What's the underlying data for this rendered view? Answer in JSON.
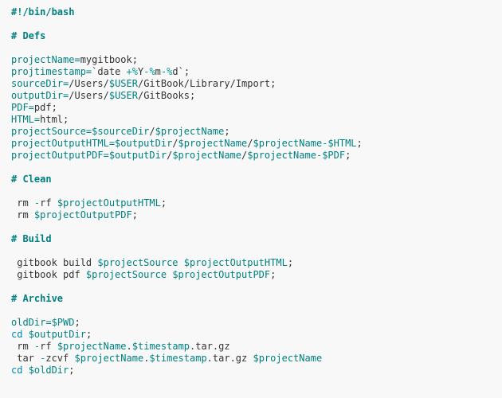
{
  "shebang": "#!/bin/bash",
  "sections": {
    "defs": "# Defs",
    "clean": "# Clean",
    "build": "# Build",
    "archive": "# Archive"
  },
  "vars": {
    "projectName": "projectName=",
    "projectNameVal": "mygitbook;",
    "projtimestamp": "projtimestamp=",
    "dateCmd": "date ",
    "dateFmt1": "+%",
    "Y": "Y",
    "dash1": "-",
    "pM": "%",
    "m": "m",
    "dash2": "-",
    "pD": "%",
    "d": "d",
    "bt2": "`",
    "semi1": ";",
    "sourceDir": "sourceDir=",
    "sourceDirVal1": "/",
    "Users1": "Users",
    "sl1": "/",
    "USER": "$USER",
    "sl2": "/",
    "gb": "GitBook",
    "sl3": "/",
    "lib": "Library",
    "sl4": "/",
    "imp": "Import;",
    "outputDir": "outputDir=",
    "od1": "/",
    "Users2": "Users",
    "sl5": "/",
    "USER2": "$USER",
    "sl6": "/",
    "gbs": "GitBooks;",
    "PDF": "PDF=",
    "pdfv": "pdf;",
    "HTML": "HTML=",
    "htmlv": "html;",
    "projectSource": "projectSource=",
    "ps1": "$sourceDir",
    "ps2": "/",
    "ps3": "$projectName",
    "ps4": ";",
    "projectOutputHTML": "projectOutputHTML=",
    "poh1": "$outputDir",
    "poh2": "/",
    "poh3": "$projectName",
    "poh4": "/",
    "poh5": "$projectName",
    "poh6": "-",
    "poh7": "$HTML",
    "poh8": ";",
    "projectOutputPDF": "projectOutputPDF=",
    "pop1": "$outputDir",
    "pop2": "/",
    "pop3": "$projectName",
    "pop4": "/",
    "pop5": "$projectName",
    "pop6": "-",
    "pop7": "$PDF",
    "pop8": ";"
  },
  "clean": {
    "l1a": " rm ",
    "l1b": "-",
    "l1c": "rf ",
    "l1d": "$projectOutputHTML",
    "l1e": ";",
    "l2a": " rm ",
    "l2b": "$projectOutputPDF",
    "l2c": ";"
  },
  "build": {
    "l1a": " gitbook build ",
    "l1b": "$projectSource",
    "l1c": " ",
    "l1d": "$projectOutputHTML",
    "l1e": ";",
    "l2a": " gitbook pdf ",
    "l2b": "$projectSource",
    "l2c": " ",
    "l2d": "$projectOutputPDF",
    "l2e": ";"
  },
  "archive": {
    "l1a": "oldDir=",
    "l1b": "$PWD",
    "l1c": ";",
    "l2a": "cd",
    "l2b": " ",
    "l2c": "$outputDir",
    "l2d": ";",
    "l3a": " rm ",
    "l3b": "-",
    "l3c": "rf ",
    "l3d": "$projectName",
    "l3e": ".",
    "l3f": "$timestamp",
    "l3g": ".tar.gz",
    "l4a": " tar ",
    "l4b": "-",
    "l4c": "zcvf ",
    "l4d": "$projectName",
    "l4e": ".",
    "l4f": "$timestamp",
    "l4g": ".tar.gz ",
    "l4h": "$projectName",
    "l5a": "cd",
    "l5b": " ",
    "l5c": "$oldDir",
    "l5d": ";"
  }
}
